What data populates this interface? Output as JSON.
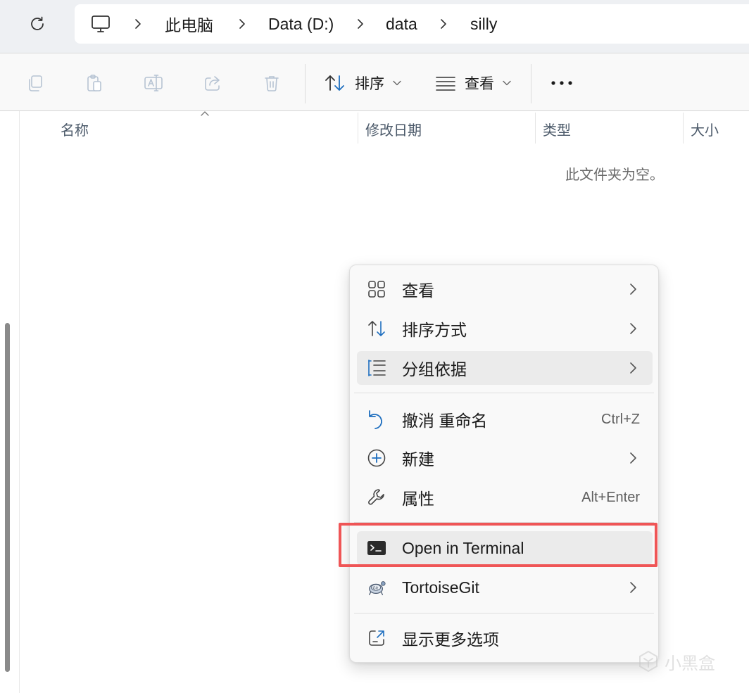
{
  "address": {
    "crumbs": [
      "此电脑",
      "Data (D:)",
      "data",
      "silly"
    ]
  },
  "toolbar": {
    "sort_label": "排序",
    "view_label": "查看"
  },
  "columns": {
    "name": "名称",
    "modified": "修改日期",
    "type": "类型",
    "size": "大小"
  },
  "content": {
    "empty_message": "此文件夹为空。"
  },
  "context_menu": {
    "items": [
      {
        "label": "查看",
        "icon": "grid-view-icon",
        "submenu": true
      },
      {
        "label": "排序方式",
        "icon": "sort-icon",
        "submenu": true
      },
      {
        "label": "分组依据",
        "icon": "group-by-icon",
        "submenu": true,
        "highlighted": true
      },
      {
        "label": "撤消 重命名",
        "icon": "undo-icon",
        "shortcut": "Ctrl+Z"
      },
      {
        "label": "新建",
        "icon": "new-plus-icon",
        "submenu": true
      },
      {
        "label": "属性",
        "icon": "wrench-icon",
        "shortcut": "Alt+Enter"
      },
      {
        "label": "Open in Terminal",
        "icon": "terminal-icon",
        "highlighted": true
      },
      {
        "label": "TortoiseGit",
        "icon": "tortoisegit-icon",
        "submenu": true
      },
      {
        "label": "显示更多选项",
        "icon": "show-more-icon"
      }
    ]
  },
  "annotation": {
    "color": "#ef5556"
  },
  "watermark": {
    "text": "小黑盒"
  }
}
